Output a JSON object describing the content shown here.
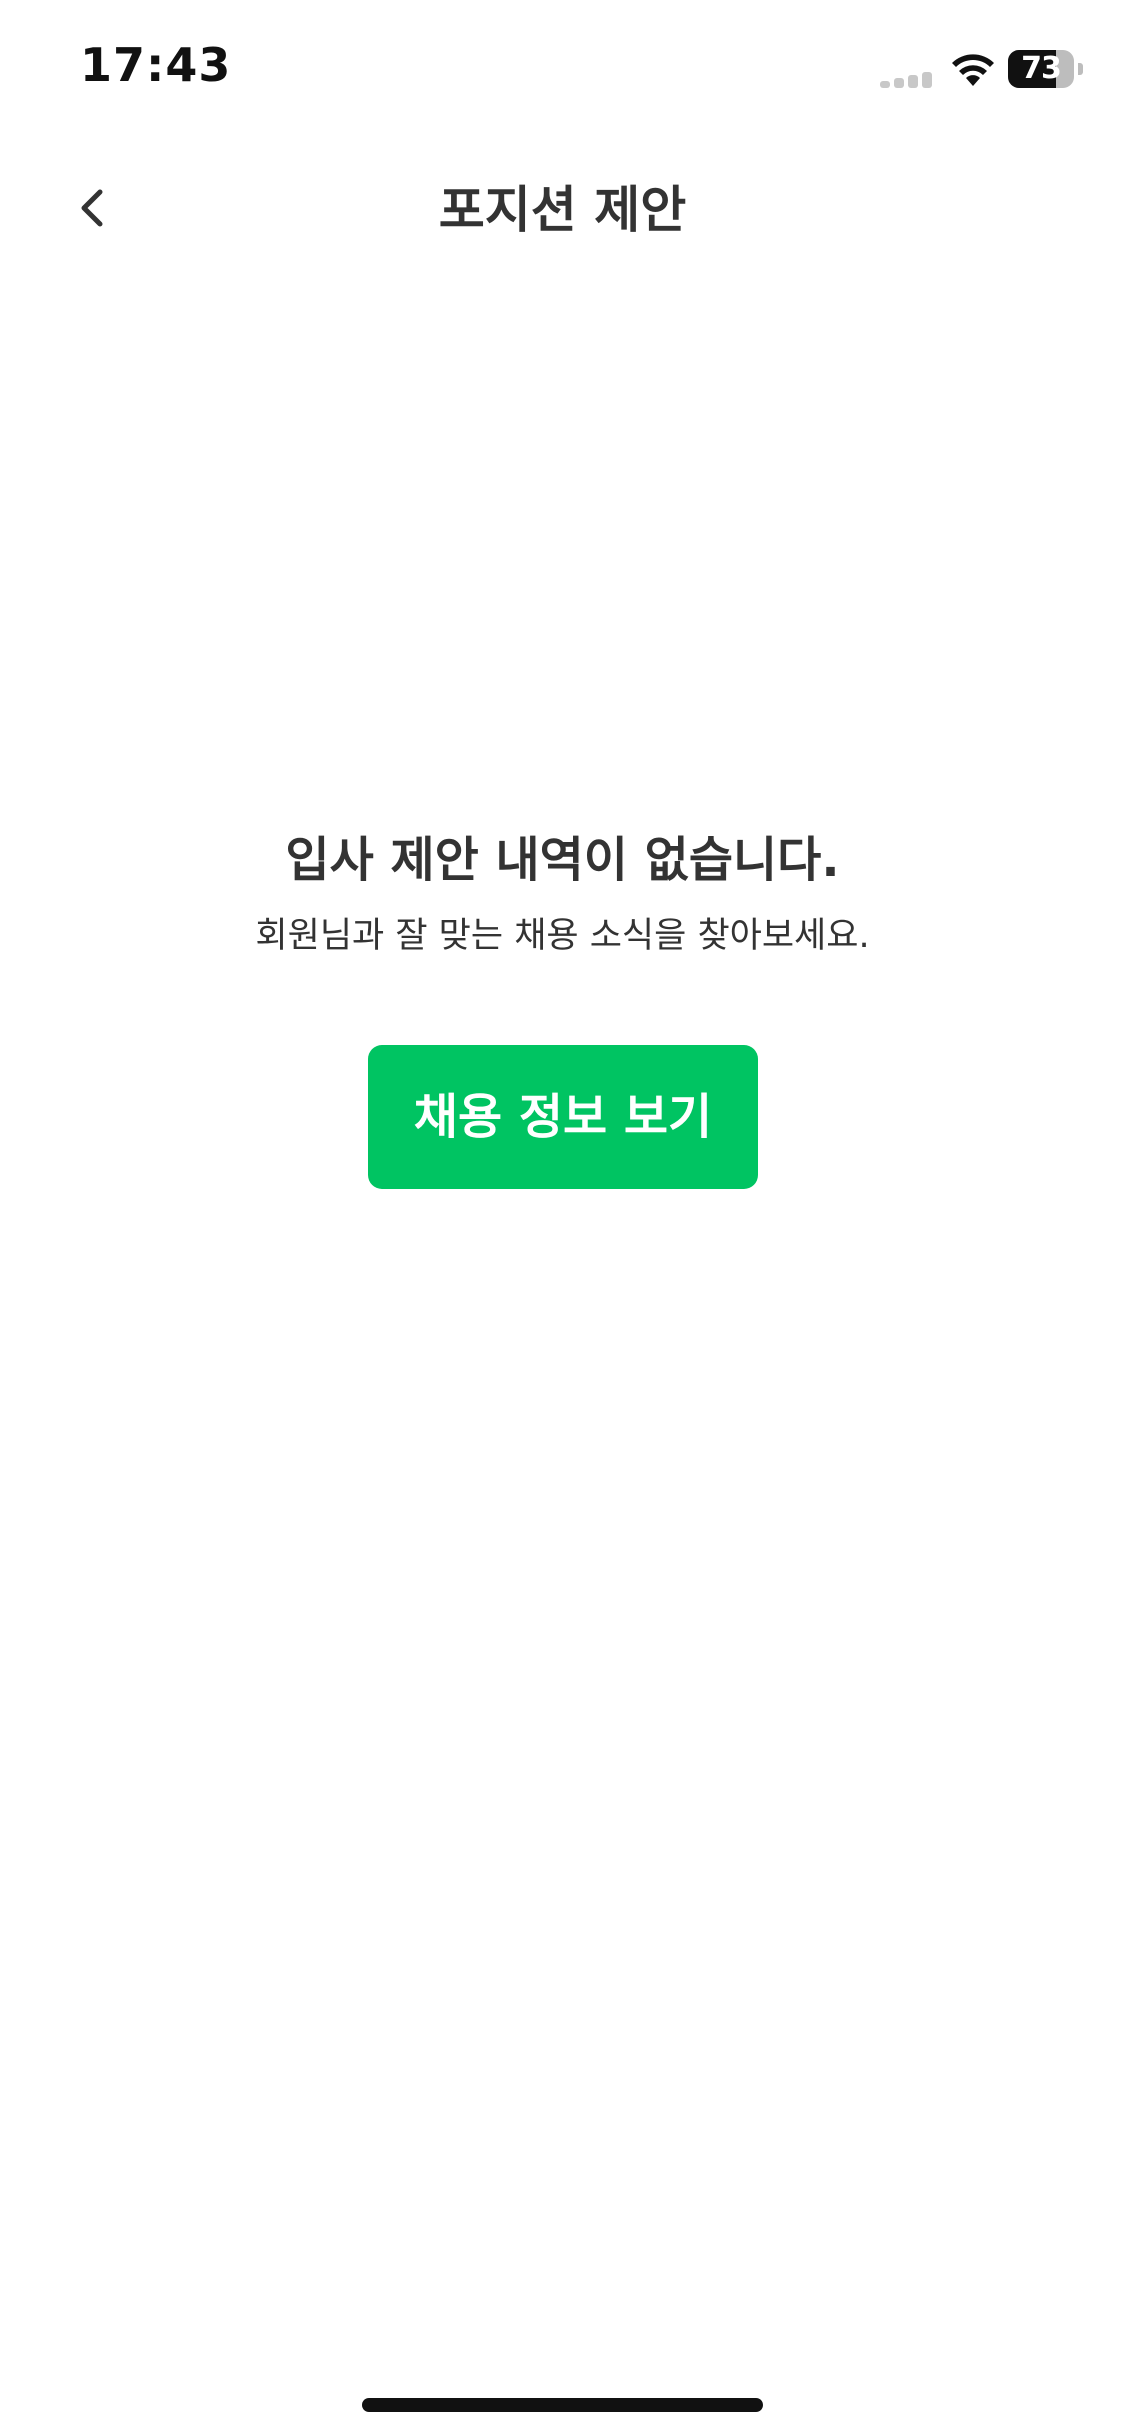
{
  "status_bar": {
    "time": "17:43",
    "battery_percent": 73,
    "battery_label": "73",
    "signal_icon": "cellular-signal-icon",
    "wifi_icon": "wifi-icon",
    "battery_icon": "battery-icon"
  },
  "nav": {
    "back_icon": "chevron-left-icon",
    "title": "포지션 제안"
  },
  "empty_state": {
    "title": "입사 제안 내역이 없습니다.",
    "subtitle": "회원님과 잘 맞는 채용 소식을 찾아보세요.",
    "button_label": "채용 정보 보기"
  },
  "colors": {
    "accent": "#00c462",
    "text": "#333333",
    "background": "#ffffff"
  }
}
